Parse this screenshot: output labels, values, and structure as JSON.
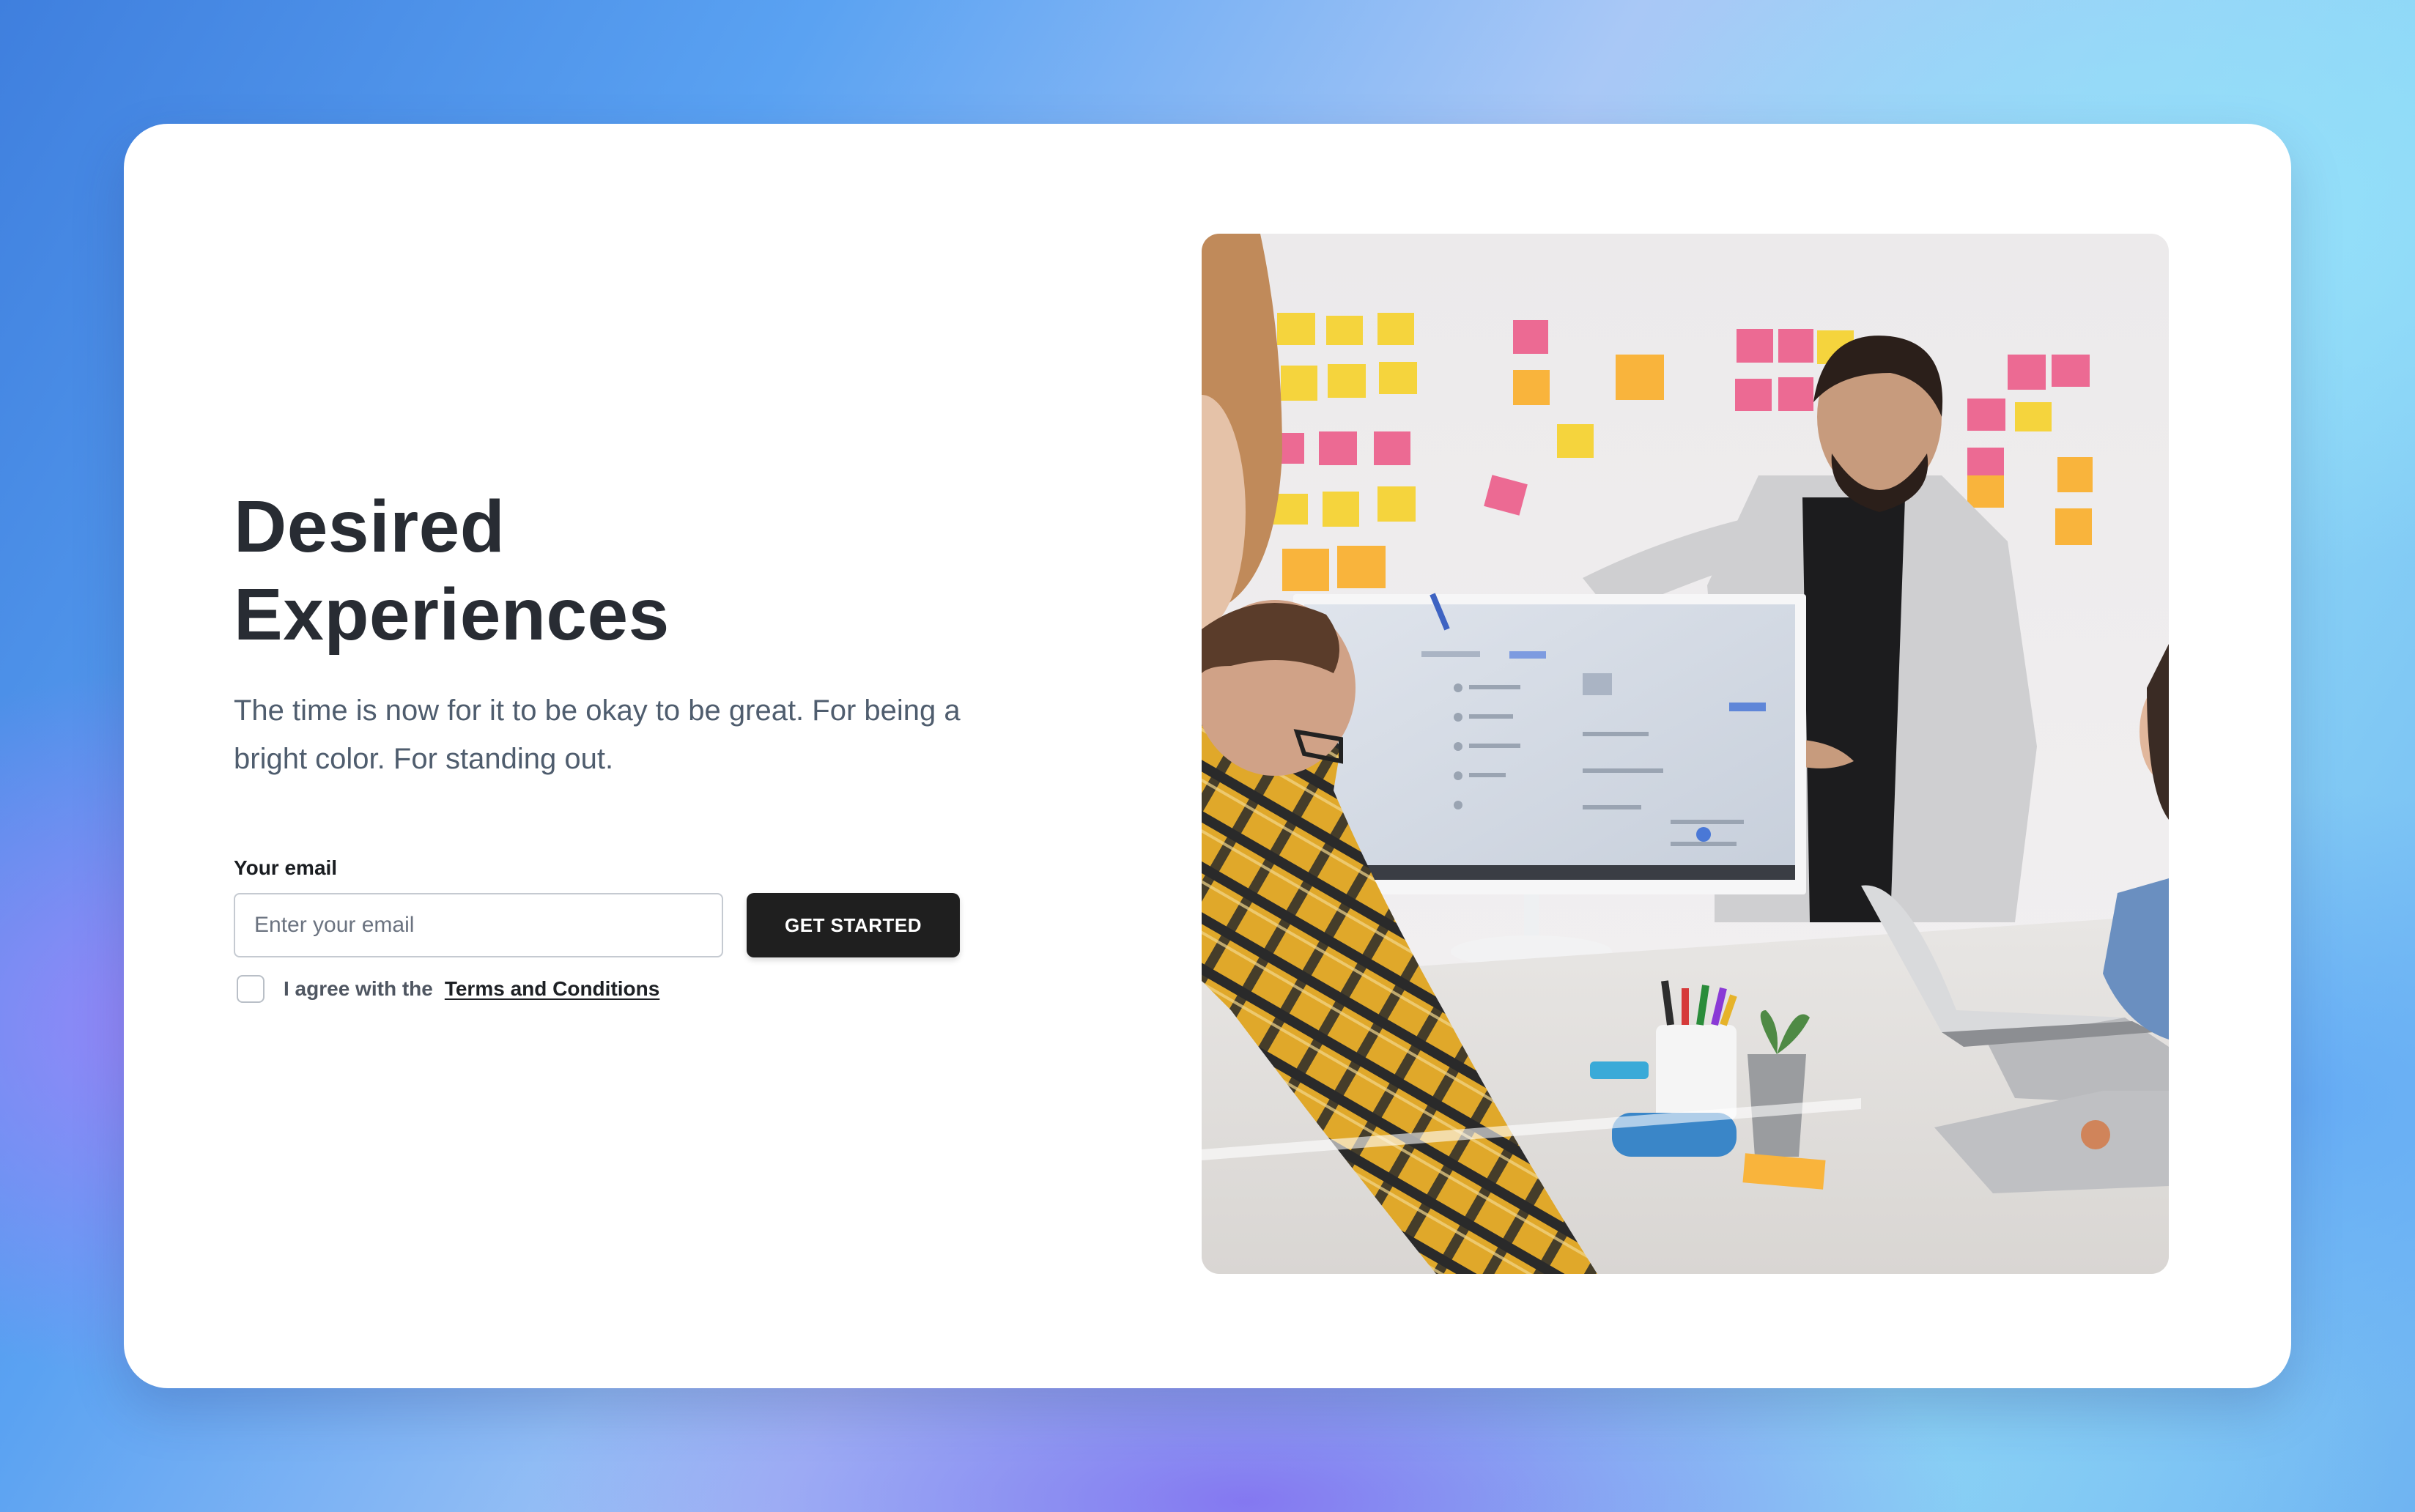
{
  "hero": {
    "title_line1": "Desired",
    "title_line2": "Experiences",
    "subtitle": "The time is now for it to be okay to be great. For being a bright color. For standing out."
  },
  "form": {
    "email_label": "Your email",
    "email_placeholder": "Enter your email",
    "email_value": "",
    "submit_label": "GET STARTED",
    "terms_prefix": "I agree with the",
    "terms_link": "Terms and Conditions",
    "terms_checked": false
  },
  "image": {
    "subject": "team-meeting-photo"
  },
  "colors": {
    "button_bg": "#1f1f1f",
    "title": "#282c33",
    "subtitle": "#4f5d6e"
  }
}
